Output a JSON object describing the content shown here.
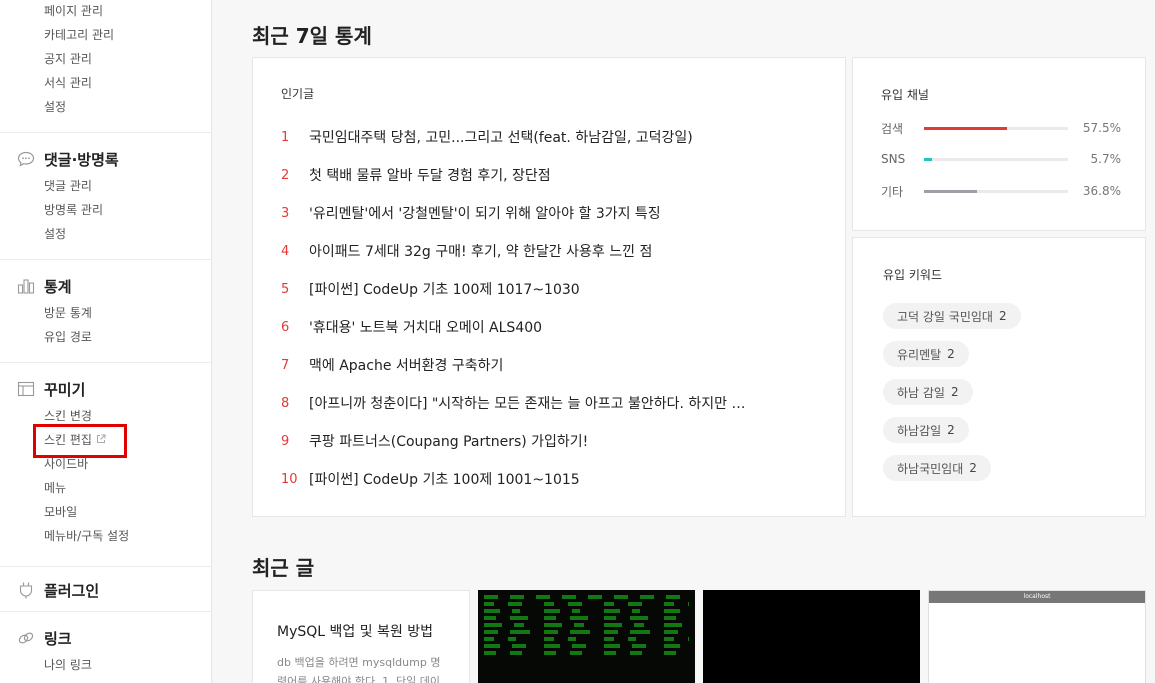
{
  "sidebar": {
    "page_items": [
      "페이지 관리",
      "카테고리 관리",
      "공지 관리",
      "서식 관리",
      "설정"
    ],
    "comments": {
      "title": "댓글·방명록",
      "items": [
        "댓글 관리",
        "방명록 관리",
        "설정"
      ]
    },
    "stats": {
      "title": "통계",
      "items": [
        "방문 통계",
        "유입 경로"
      ]
    },
    "decorate": {
      "title": "꾸미기",
      "items": [
        "스킨 변경",
        "스킨 편집",
        "사이드바",
        "메뉴",
        "모바일",
        "메뉴바/구독 설정"
      ]
    },
    "plugin": {
      "title": "플러그인"
    },
    "link": {
      "title": "링크",
      "items": [
        "나의 링크"
      ]
    }
  },
  "main": {
    "stats_title": "최근 7일 통계",
    "popular": {
      "caption": "인기글",
      "posts": [
        {
          "rank": "1",
          "title": "국민임대주택 당첨, 고민...그리고 선택(feat. 하남감일, 고덕강일)"
        },
        {
          "rank": "2",
          "title": "첫 택배 물류 알바 두달 경험 후기, 장단점"
        },
        {
          "rank": "3",
          "title": "'유리멘탈'에서 '강철멘탈'이 되기 위해 알아야 할 3가지 특징"
        },
        {
          "rank": "4",
          "title": "아이패드 7세대 32g 구매! 후기, 약 한달간 사용후 느낀 점"
        },
        {
          "rank": "5",
          "title": "[파이썬] CodeUp 기초 100제 1017~1030"
        },
        {
          "rank": "6",
          "title": "'휴대용' 노트북 거치대 오메이 ALS400"
        },
        {
          "rank": "7",
          "title": "맥에 Apache 서버환경 구축하기"
        },
        {
          "rank": "8",
          "title": "[아프니까 청춘이다] \"시작하는 모든 존재는 늘 아프고 불안하다. 하지만 …"
        },
        {
          "rank": "9",
          "title": "쿠팡 파트너스(Coupang Partners) 가입하기!"
        },
        {
          "rank": "10",
          "title": "[파이썬] CodeUp 기초 100제 1001~1015"
        }
      ]
    },
    "channel": {
      "caption": "유입 채널",
      "rows": [
        {
          "label": "검색",
          "percent": "57.5%",
          "ratio": 0.575,
          "color": "#e53935"
        },
        {
          "label": "SNS",
          "percent": "5.7%",
          "ratio": 0.057,
          "color": "#1ac6c6"
        },
        {
          "label": "기타",
          "percent": "36.8%",
          "ratio": 0.368,
          "color": "#9aa0a6"
        }
      ]
    },
    "keywords": {
      "caption": "유입 키워드",
      "items": [
        {
          "word": "고덕 강일 국민임대",
          "count": "2"
        },
        {
          "word": "유리멘탈",
          "count": "2"
        },
        {
          "word": "하남 감일",
          "count": "2"
        },
        {
          "word": "하남감일",
          "count": "2"
        },
        {
          "word": "하남국민임대",
          "count": "2"
        }
      ]
    },
    "recent_title": "최근 글",
    "recent": {
      "title": "MySQL 백업 및 복원 방법",
      "desc": "db 백업을 하려면 mysqldump 명령어를 사용해야 한다. 1. 단일 데이"
    },
    "thumb_window_title": "localhost"
  },
  "colors": {
    "accent": "#e53935",
    "highlight": "#e10000"
  }
}
